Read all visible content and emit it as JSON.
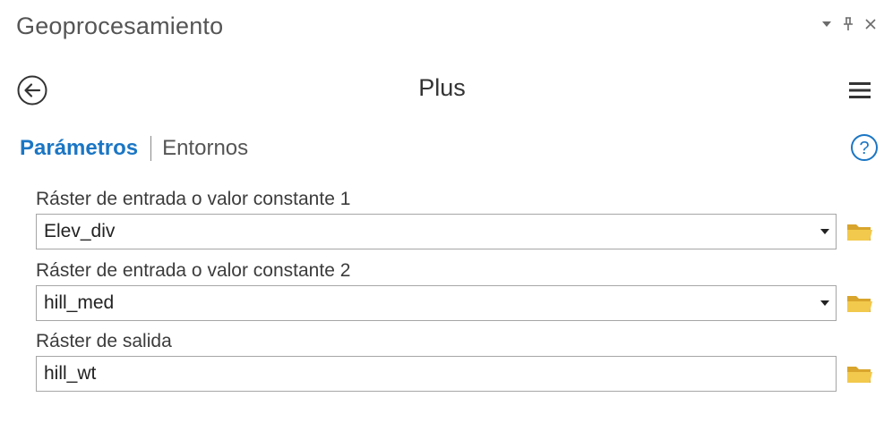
{
  "pane": {
    "title": "Geoprocesamiento"
  },
  "tool": {
    "name": "Plus"
  },
  "tabs": [
    {
      "label": "Parámetros",
      "active": true
    },
    {
      "label": "Entornos",
      "active": false
    }
  ],
  "parameters": [
    {
      "label": "Ráster de entrada o valor constante 1",
      "value": "Elev_div",
      "has_dropdown": true
    },
    {
      "label": "Ráster de entrada o valor constante 2",
      "value": "hill_med",
      "has_dropdown": true
    },
    {
      "label": "Ráster de salida",
      "value": "hill_wt",
      "has_dropdown": false
    }
  ],
  "icons": {
    "options": "chevron-down-icon",
    "pin": "pin-icon",
    "close": "close-icon",
    "back": "back-arrow-icon",
    "menu": "hamburger-menu-icon",
    "help": "help-icon",
    "browse": "folder-icon",
    "dropdown": "dropdown-arrow-icon"
  },
  "colors": {
    "accent": "#1b76c4",
    "folder": "#e8b83a",
    "text": "#2b2b2b",
    "muted": "#555555",
    "border": "#a6a6a6"
  }
}
